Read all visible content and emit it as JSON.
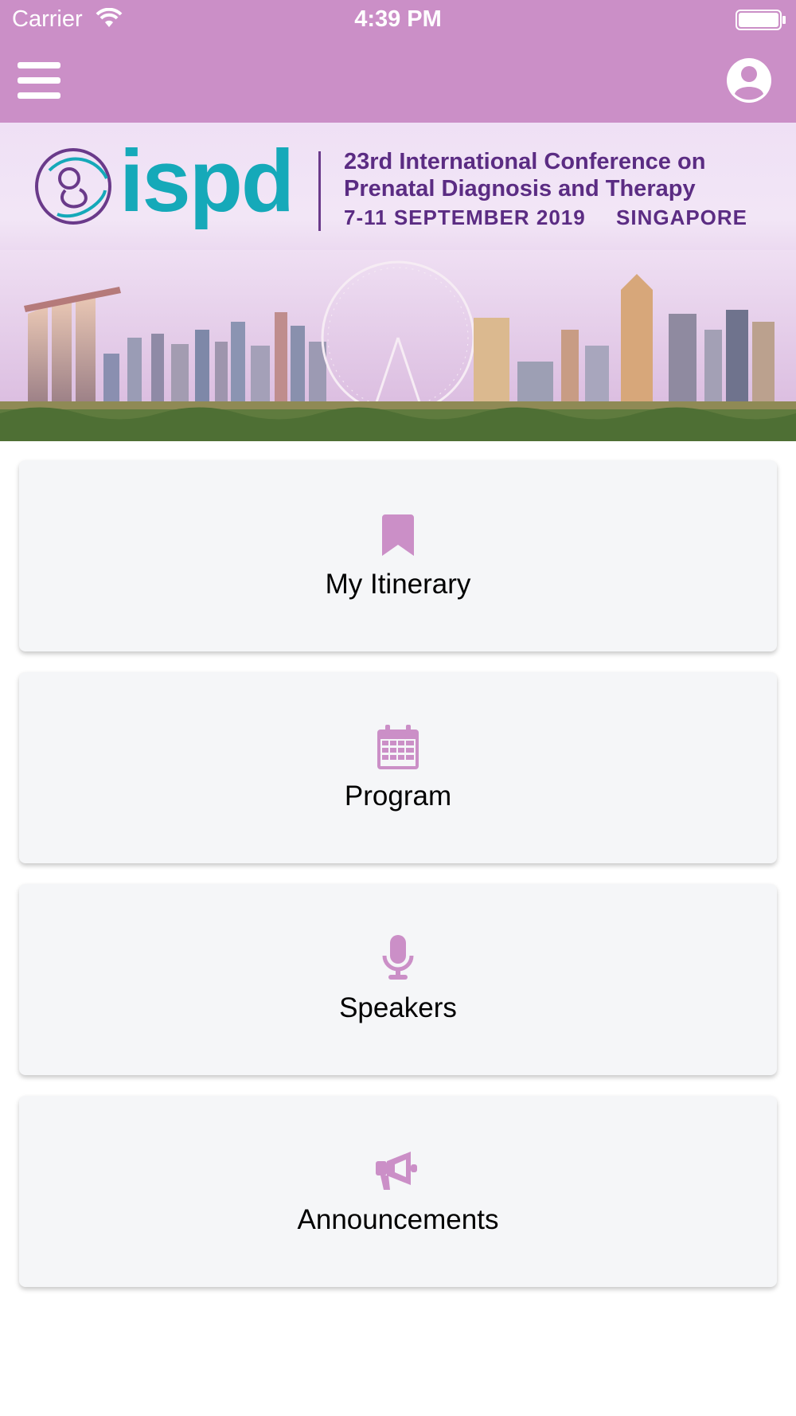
{
  "status_bar": {
    "carrier": "Carrier",
    "time": "4:39 PM"
  },
  "header": {
    "accent_color": "#cb8fc7",
    "menu_icon": "hamburger-menu-icon",
    "profile_icon": "user-circle-icon"
  },
  "banner": {
    "brand": "ispd",
    "title_line1": "23rd International Conference on",
    "title_line2": "Prenatal Diagnosis and Therapy",
    "dates": "7-11 SEPTEMBER 2019",
    "location": "SINGAPORE"
  },
  "menu": {
    "items": [
      {
        "label": "My Itinerary",
        "icon": "bookmark-icon"
      },
      {
        "label": "Program",
        "icon": "calendar-icon"
      },
      {
        "label": "Speakers",
        "icon": "microphone-icon"
      },
      {
        "label": "Announcements",
        "icon": "megaphone-icon"
      }
    ],
    "icon_color": "#cb8fc7"
  }
}
